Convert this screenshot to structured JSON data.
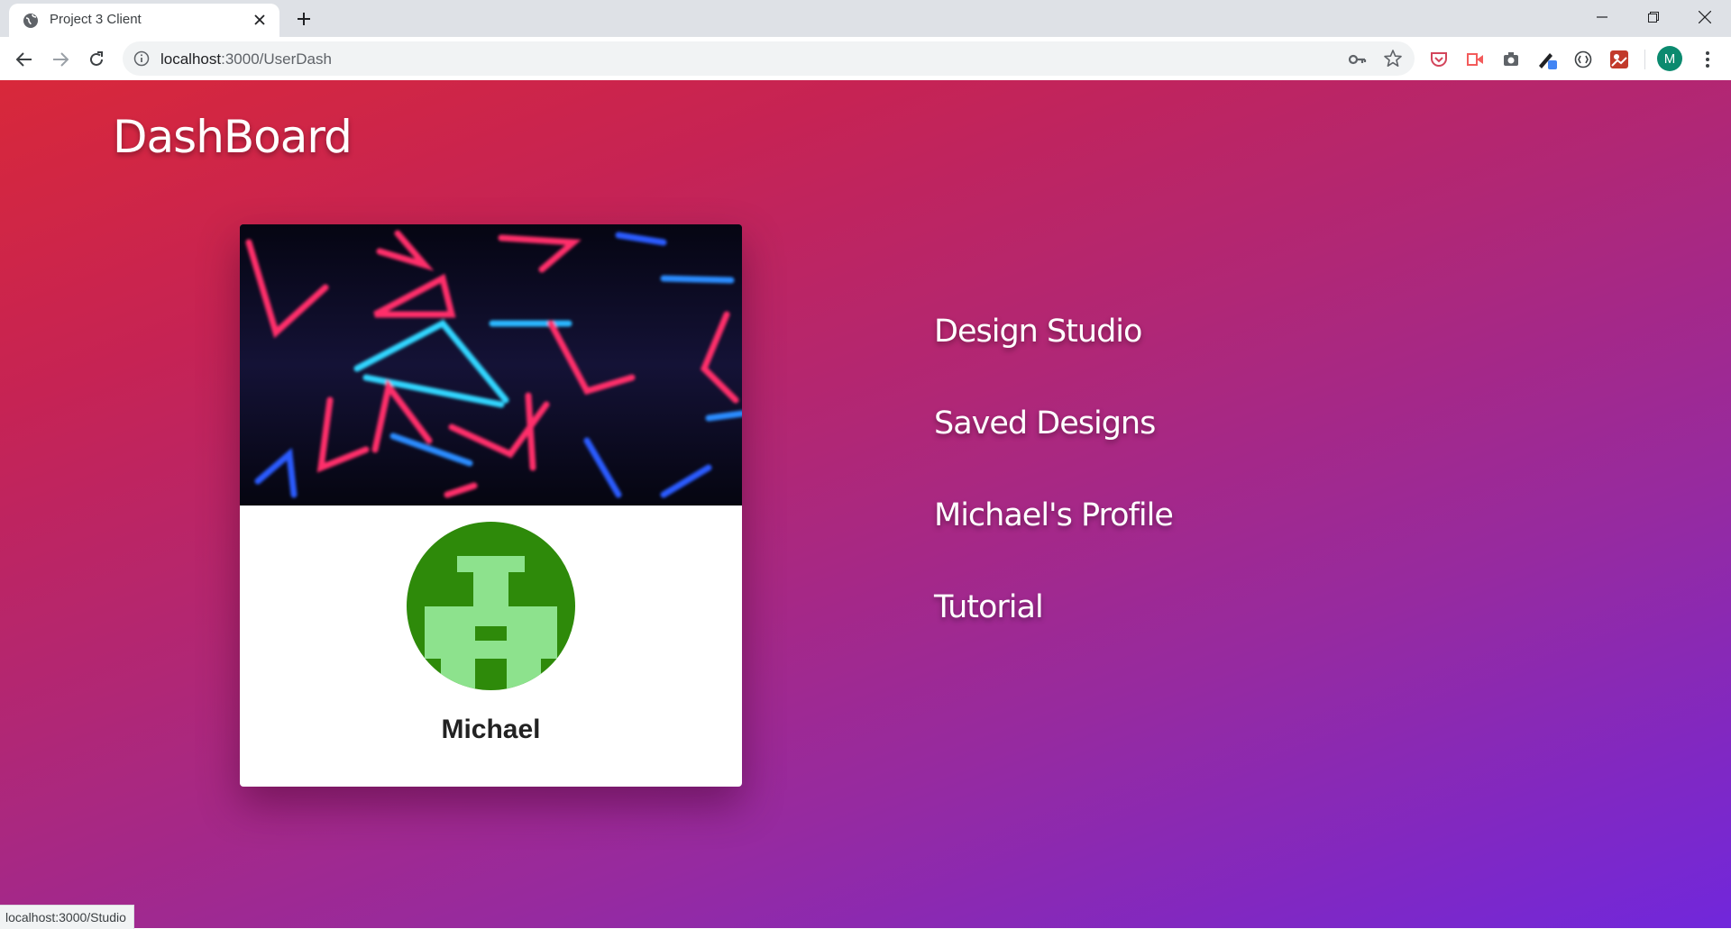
{
  "browser": {
    "tab_title": "Project 3 Client",
    "url_host": "localhost",
    "url_path": ":3000/UserDash",
    "profile_initial": "M",
    "status_url": "localhost:3000/Studio"
  },
  "page": {
    "title": "DashBoard",
    "user_name": "Michael",
    "menu": [
      "Design Studio",
      "Saved Designs",
      "Michael's Profile",
      "Tutorial"
    ]
  },
  "colors": {
    "gradient_start": "#d8283a",
    "gradient_end": "#7127db",
    "avatar_dark": "#2e8a0a",
    "avatar_light": "#8de28d"
  },
  "icons": [
    "globe-icon",
    "close-icon",
    "plus-icon",
    "minimize-icon",
    "restore-icon",
    "window-close-icon",
    "back-icon",
    "forward-icon",
    "reload-icon",
    "info-icon",
    "key-icon",
    "star-icon",
    "pocket-icon",
    "video-extension-icon",
    "camera-icon",
    "color-picker-icon",
    "extension-icon",
    "gallery-extension-icon",
    "more-icon"
  ]
}
